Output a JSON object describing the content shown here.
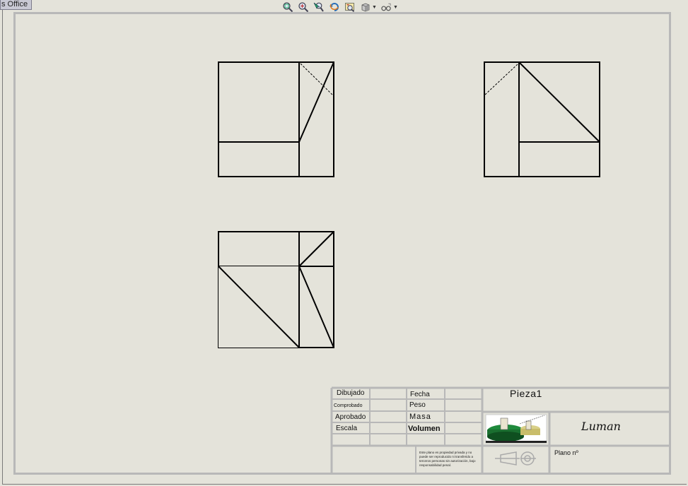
{
  "window": {
    "tab_label": "s Office"
  },
  "toolbar": {
    "icons": [
      "zoom-to-fit-icon",
      "zoom-area-icon",
      "zoom-select-icon",
      "rotate-view-icon",
      "previous-view-icon",
      "display-style-icon",
      "view-settings-icon"
    ]
  },
  "title_block": {
    "labels": {
      "dibujado": "Dibujado",
      "comprobado": "Comprobado",
      "aprobado": "Aprobado",
      "escala": "Escala",
      "fecha": "Fecha",
      "peso": "Peso",
      "masa": "Masa",
      "volumen": "Volumen",
      "plano": "Plano nº"
    },
    "part_name": "Pieza1",
    "signature": "Luman",
    "fine_print": "Este plano es propiedad privada y no puede ser reproducido ni transferido a terceros personas sin autorización, bajo responsabilidad penal."
  },
  "colors": {
    "sheet_background": "#e4e3da",
    "sheet_border": "#b8b8b8",
    "line": "#000000"
  }
}
